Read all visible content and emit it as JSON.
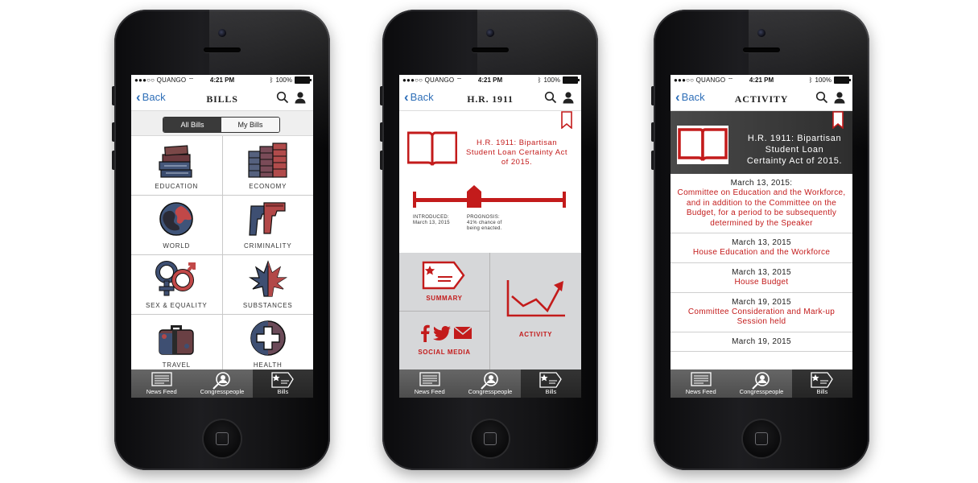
{
  "status_bar": {
    "carrier": "QUANGO",
    "time": "4:21 PM",
    "battery": "100%"
  },
  "nav": {
    "back_label": "Back"
  },
  "tabs": [
    {
      "label": "News Feed",
      "icon": "newspaper-icon"
    },
    {
      "label": "Congresspeople",
      "icon": "person-magnify-icon"
    },
    {
      "label": "Bills",
      "icon": "bill-flag-icon"
    }
  ],
  "bills_screen": {
    "title": "BILLS",
    "segments": {
      "all": "All Bills",
      "mine": "My Bills",
      "selected": "All Bills"
    },
    "categories": [
      {
        "label": "EDUCATION",
        "icon": "books-icon"
      },
      {
        "label": "ECONOMY",
        "icon": "money-stacks-icon"
      },
      {
        "label": "WORLD",
        "icon": "globe-icon"
      },
      {
        "label": "CRIMINALITY",
        "icon": "handguns-icon"
      },
      {
        "label": "SEX & EQUALITY",
        "icon": "gender-symbols-icon"
      },
      {
        "label": "SUBSTANCES",
        "icon": "leaf-icon"
      },
      {
        "label": "TRAVEL",
        "icon": "suitcase-icon"
      },
      {
        "label": "HEALTH",
        "icon": "medical-cross-icon"
      }
    ]
  },
  "bill_screen": {
    "title": "H.R. 1911",
    "bill_title": "H.R. 1911:  Bipartisan Student Loan Certainty Act of 2015.",
    "introduced_label": "INTRODUCED:",
    "introduced_date": "March 13, 2015",
    "prognosis_label": "PROGNOSIS:",
    "prognosis_text": "41% chance of being enacted.",
    "tiles": {
      "summary": "SUMMARY",
      "social": "SOCIAL MEDIA",
      "activity": "ACTIVITY"
    }
  },
  "activity_screen": {
    "title": "ACTIVITY",
    "bill_title": "H.R. 1911:  Bipartisan Student Loan Certainty Act of 2015.",
    "items": [
      {
        "date": "March 13, 2015:",
        "event": "Committee on Education and the Workforce, and in addition to the Committee on the Budget, for a period to be subsequently determined by the Speaker"
      },
      {
        "date": "March 13, 2015",
        "event": "House Education and the Workforce"
      },
      {
        "date": "March 13, 2015",
        "event": "House Budget"
      },
      {
        "date": "March 19, 2015",
        "event": "Committee Consideration and Mark-up Session held"
      },
      {
        "date": "March 19, 2015",
        "event": ""
      }
    ]
  },
  "colors": {
    "accent": "#c31b1b",
    "link": "#2f6fb8",
    "tab_bar": "#555555"
  }
}
